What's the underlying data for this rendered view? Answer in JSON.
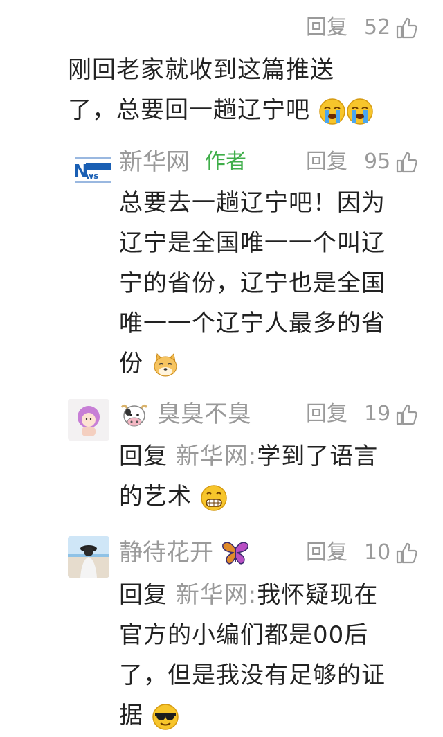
{
  "top_row": {
    "reply": "回复",
    "likes": "52"
  },
  "main_comment": {
    "text_line1": "刚回老家就收到这篇推送",
    "text_line2": "了，总要回一趟辽宁吧"
  },
  "replies": [
    {
      "name": "新华网",
      "tag": "作者",
      "reply": "回复",
      "likes": "95",
      "avatar_text": "新华网",
      "lines": [
        "总要去一趟辽宁吧！因为",
        "辽宁是全国唯一一个叫辽",
        "宁的省份，辽宁也是全国",
        "唯一一个辽宁人最多的省",
        "份"
      ]
    },
    {
      "name": "臭臭不臭",
      "reply": "回复",
      "likes": "19",
      "prefix": "回复",
      "target": "新华网:",
      "lines": [
        "学到了语言",
        "的艺术"
      ]
    },
    {
      "name": "静待花开",
      "reply": "回复",
      "likes": "10",
      "prefix": "回复",
      "target": "新华网:",
      "lines": [
        "我怀疑现在",
        "官方的小编们都是00后",
        "了，但是我没有足够的证",
        "据"
      ]
    }
  ],
  "colors": {
    "author_tag": "#3fae4a",
    "meta_gray": "#9a9a9a",
    "text": "#222222"
  }
}
